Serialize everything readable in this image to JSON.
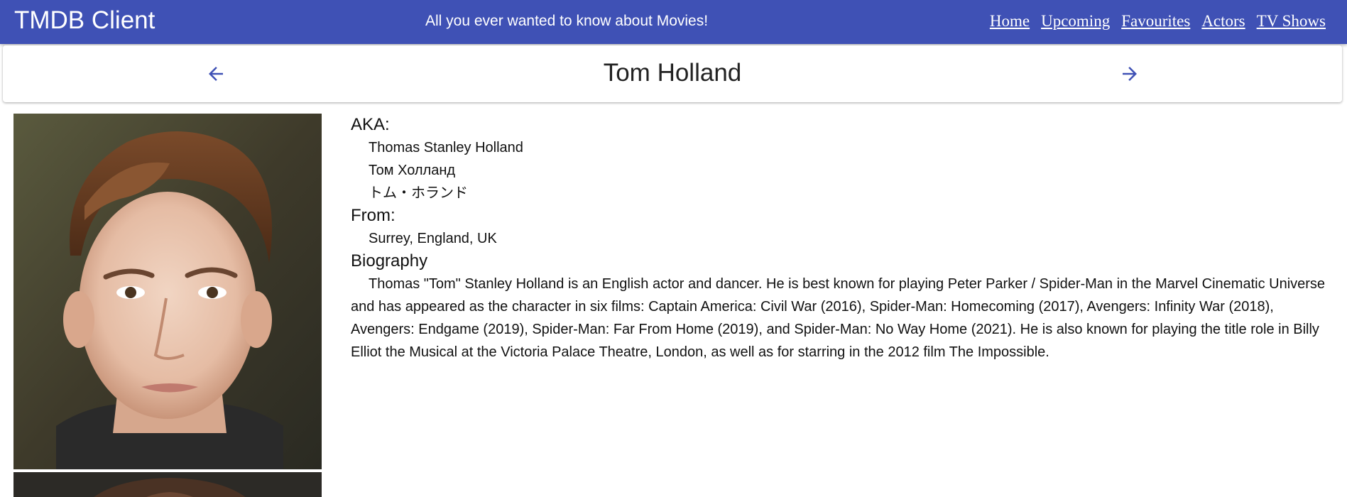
{
  "appbar": {
    "title": "TMDB Client",
    "tagline": "All you ever wanted to know about Movies!",
    "nav": [
      {
        "label": "Home"
      },
      {
        "label": "Upcoming"
      },
      {
        "label": "Favourites"
      },
      {
        "label": "Actors"
      },
      {
        "label": "TV Shows"
      }
    ],
    "color": "#3f51b5"
  },
  "header": {
    "name": "Tom Holland",
    "prev_icon": "arrow-back-icon",
    "next_icon": "arrow-forward-icon",
    "arrow_color": "#3f51b5"
  },
  "photos": [
    {
      "alt": "Tom Holland profile photo"
    },
    {
      "alt": "Tom Holland second photo"
    }
  ],
  "details": {
    "aka_label": "AKA:",
    "aka": [
      "Thomas Stanley Holland",
      "Том Холланд",
      "トム・ホランド"
    ],
    "from_label": "From:",
    "from_value": "Surrey, England, UK",
    "bio_label": "Biography",
    "bio": "Thomas \"Tom\" Stanley Holland is an English actor and dancer. He is best known for playing Peter Parker / Spider-Man in the Marvel Cinematic Universe and has appeared as the character in six films: Captain America: Civil War (2016), Spider-Man: Homecoming (2017), Avengers: Infinity War (2018), Avengers: Endgame (2019), Spider-Man: Far From Home (2019), and Spider-Man: No Way Home (2021). He is also known for playing the title role in Billy Elliot the Musical at the Victoria Palace Theatre, London, as well as for starring in the 2012 film The Impossible."
  }
}
